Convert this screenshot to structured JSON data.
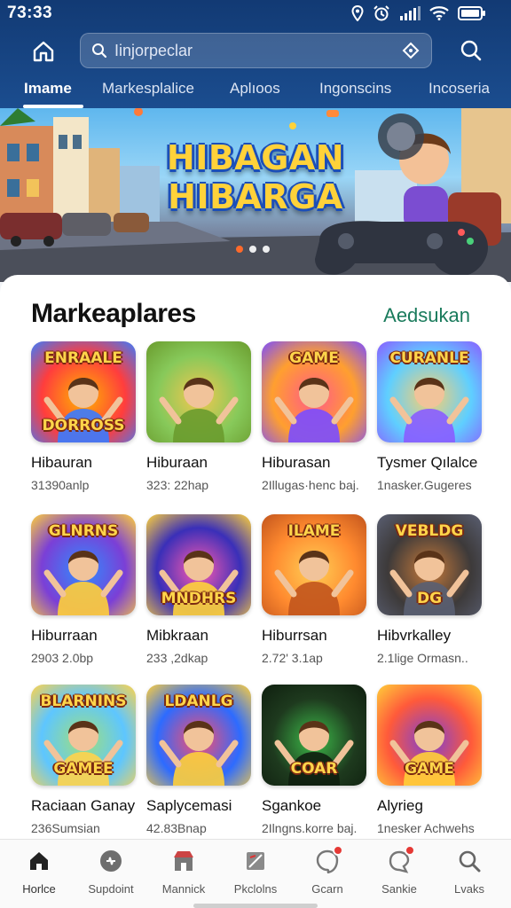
{
  "status": {
    "time": "73:33"
  },
  "header": {
    "search_placeholder": "Iinjorpeclar",
    "home_icon": "home-icon",
    "search_icon": "search-icon"
  },
  "tabs": [
    {
      "label": "Imame",
      "active": true
    },
    {
      "label": "Markesplalice",
      "active": false
    },
    {
      "label": "Aplıoos",
      "active": false
    },
    {
      "label": "Ingonscins",
      "active": false
    },
    {
      "label": "Incoseria",
      "active": false
    }
  ],
  "banner": {
    "title_line1": "HIBAGAN",
    "title_line2": "HIBARGA",
    "dots": 3,
    "active_dot": 0
  },
  "section": {
    "title": "Markeaplares",
    "link": "Aedsukan"
  },
  "games": [
    {
      "title": "Hibauran",
      "sub": "31390anlp",
      "thumb_text": "ENRAALE",
      "thumb_text2": "DORROSS",
      "colors": [
        "#ff3d3d",
        "#ffb400",
        "#3a7bff"
      ]
    },
    {
      "title": "Hiburaan",
      "sub": "323: 22hap",
      "thumb_text": "",
      "thumb_text2": "",
      "colors": [
        "#87c95a",
        "#f3c74f",
        "#6a9b2d"
      ]
    },
    {
      "title": "Hiburasan",
      "sub": "2Illugas·henc baj.",
      "thumb_text": "GAME",
      "thumb_text2": "",
      "colors": [
        "#ff9f2f",
        "#ff5a8a",
        "#7b4dff"
      ]
    },
    {
      "title": "Tysmer Qılalce",
      "sub": "1nasker.Gugeres",
      "thumb_text": "CURANLE",
      "thumb_text2": "",
      "colors": [
        "#5fcfff",
        "#ffcf6b",
        "#8a5cff"
      ]
    },
    {
      "title": "Hiburraan",
      "sub": "2903 2.0bp",
      "thumb_text": "GLNRNS",
      "thumb_text2": "",
      "colors": [
        "#7b3fd6",
        "#2f8dff",
        "#ffcf3a"
      ]
    },
    {
      "title": "Mibkraan",
      "sub": "233 ,2dkap",
      "thumb_text": "",
      "thumb_text2": "MNDHRS",
      "colors": [
        "#3a2fb8",
        "#ff5ab0",
        "#ffd23a"
      ]
    },
    {
      "title": "Hiburrsan",
      "sub": "2.72' 3.1ap",
      "thumb_text": "ILAME",
      "thumb_text2": "",
      "colors": [
        "#ff8a2f",
        "#ffcf55",
        "#c2551d"
      ]
    },
    {
      "title": "Hibvrkalley",
      "sub": "2.1lige Ormasn..",
      "thumb_text": "VEBLDG",
      "thumb_text2": "DG",
      "colors": [
        "#3d3a3a",
        "#c77a3b",
        "#5a5f72"
      ]
    },
    {
      "title": "Raciaan Ganay",
      "sub": "236Sumsian",
      "thumb_text": "BLARNINS",
      "thumb_text2": "GAMEE",
      "colors": [
        "#5ec6ff",
        "#9fe07a",
        "#ffd34a"
      ]
    },
    {
      "title": "Saplycemasi",
      "sub": "42.83Bnap",
      "thumb_text": "LDANLG",
      "thumb_text2": "",
      "colors": [
        "#2d6bff",
        "#ff4d6a",
        "#ffcf3a"
      ]
    },
    {
      "title": "Sgankoе",
      "sub": "2Ilngns.korre baj.",
      "thumb_text": "",
      "thumb_text2": "COAR",
      "colors": [
        "#1e3a1e",
        "#3dbd4a",
        "#0f1f0f"
      ]
    },
    {
      "title": "Alyrieg",
      "sub": "1nesker Achwehs",
      "thumb_text": "",
      "thumb_text2": "GAME",
      "colors": [
        "#ff5a3a",
        "#7b3fd6",
        "#ffcf3a"
      ]
    }
  ],
  "bottom_nav": [
    {
      "label": "Horlce",
      "icon": "home-icon",
      "active": true,
      "badge": false
    },
    {
      "label": "Supdoint",
      "icon": "support-icon",
      "active": false,
      "badge": false
    },
    {
      "label": "Mannick",
      "icon": "store-icon",
      "active": false,
      "badge": false
    },
    {
      "label": "Pkclolns",
      "icon": "tag-icon",
      "active": false,
      "badge": false
    },
    {
      "label": "Gcarn",
      "icon": "game-icon",
      "active": false,
      "badge": true
    },
    {
      "label": "Sankie",
      "icon": "share-icon",
      "active": false,
      "badge": true
    },
    {
      "label": "Lvaks",
      "icon": "search-icon",
      "active": false,
      "badge": false
    }
  ]
}
